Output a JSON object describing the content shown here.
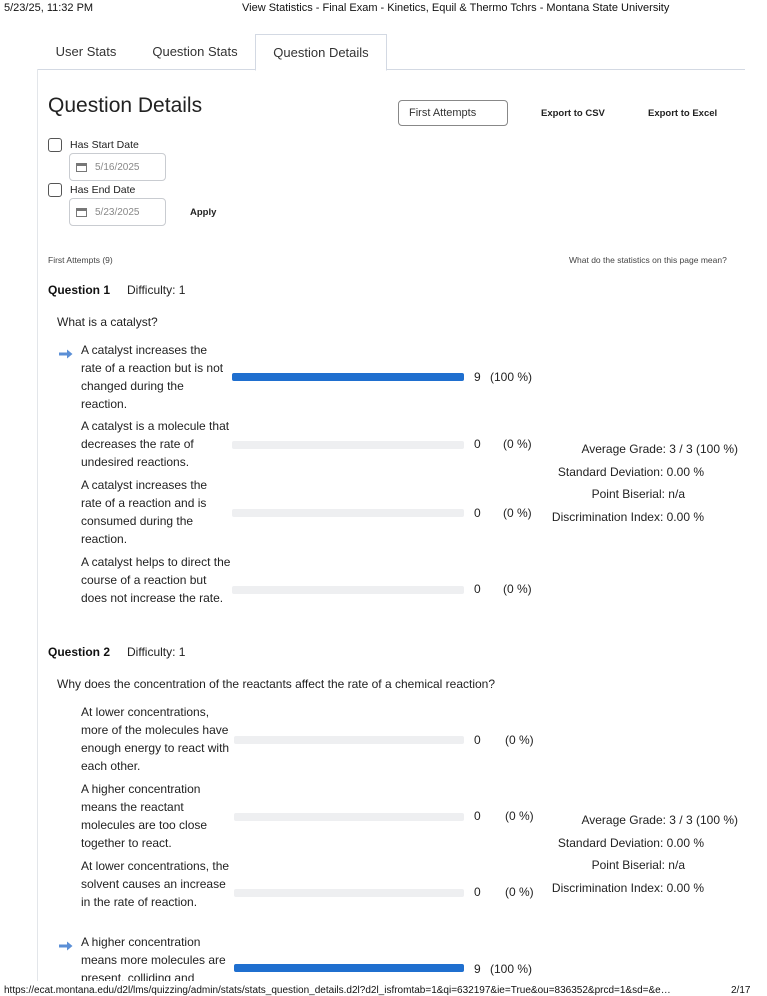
{
  "print_header": {
    "datetime": "5/23/25, 11:32 PM",
    "page_title": "View Statistics - Final Exam - Kinetics, Equil & Thermo Tchrs - Montana State University"
  },
  "tabs": [
    {
      "label": "User Stats",
      "active": false
    },
    {
      "label": "Question Stats",
      "active": false
    },
    {
      "label": "Question Details",
      "active": true
    }
  ],
  "title": "Question Details",
  "attempts_select": "First Attempts",
  "export_csv": "Export to CSV",
  "export_excel": "Export to Excel",
  "start_date": {
    "label": "Has Start Date",
    "value": "5/16/2025"
  },
  "end_date": {
    "label": "Has End Date",
    "value": "5/23/2025"
  },
  "apply": "Apply",
  "attempts_count": "First Attempts (9)",
  "help_link": "What do the statistics on this page mean?",
  "questions": [
    {
      "title": "Question 1",
      "difficulty": "Difficulty: 1",
      "text": "What is a catalyst?",
      "answers": [
        {
          "text": "A catalyst increases the rate of a reaction but is not changed during the reaction.",
          "count": "9",
          "pct": "(100 %)",
          "fraction": 1.0,
          "correct": true
        },
        {
          "text": "A catalyst is a molecule that decreases the rate of undesired reactions.",
          "count": "0",
          "pct": "(0 %)",
          "fraction": 0.0,
          "correct": false
        },
        {
          "text": "A catalyst increases the rate of a reaction and is consumed during the reaction.",
          "count": "0",
          "pct": "(0 %)",
          "fraction": 0.0,
          "correct": false
        },
        {
          "text": "A catalyst helps to direct the course of a reaction but does not increase the rate.",
          "count": "0",
          "pct": "(0 %)",
          "fraction": 0.0,
          "correct": false
        }
      ],
      "stats": {
        "avg": "Average Grade: 3 / 3 (100 %)",
        "sd": "Standard Deviation: 0.00 %",
        "pb": "Point Biserial: n/a",
        "di": "Discrimination Index: 0.00 %"
      }
    },
    {
      "title": "Question 2",
      "difficulty": "Difficulty: 1",
      "text": "Why does the concentration of the reactants affect the rate of a chemical reaction?",
      "answers": [
        {
          "text": "At lower concentrations, more of the molecules have enough energy to react with each other.",
          "count": "0",
          "pct": "(0 %)",
          "fraction": 0.0,
          "correct": false
        },
        {
          "text": "A higher concentration means the reactant molecules are too close together to react.",
          "count": "0",
          "pct": "(0 %)",
          "fraction": 0.0,
          "correct": false
        },
        {
          "text": "At lower concentrations, the solvent causes an increase in the rate of reaction.",
          "count": "0",
          "pct": "(0 %)",
          "fraction": 0.0,
          "correct": false
        },
        {
          "text": "A higher concentration means more molecules are present, colliding and",
          "count": "9",
          "pct": "(100 %)",
          "fraction": 1.0,
          "correct": true
        }
      ],
      "stats": {
        "avg": "Average Grade: 3 / 3 (100 %)",
        "sd": "Standard Deviation: 0.00 %",
        "pb": "Point Biserial: n/a",
        "di": "Discrimination Index: 0.00 %"
      }
    }
  ],
  "footer": {
    "url": "https://ecat.montana.edu/d2l/lms/quizzing/admin/stats/stats_question_details.d2l?d2l_isfromtab=1&qi=632197&ie=True&ou=836352&prcd=1&sd=&e…",
    "page": "2/17"
  },
  "colors": {
    "accent": "#1f6fcf",
    "correct_arrow": "#5b8fd6"
  }
}
